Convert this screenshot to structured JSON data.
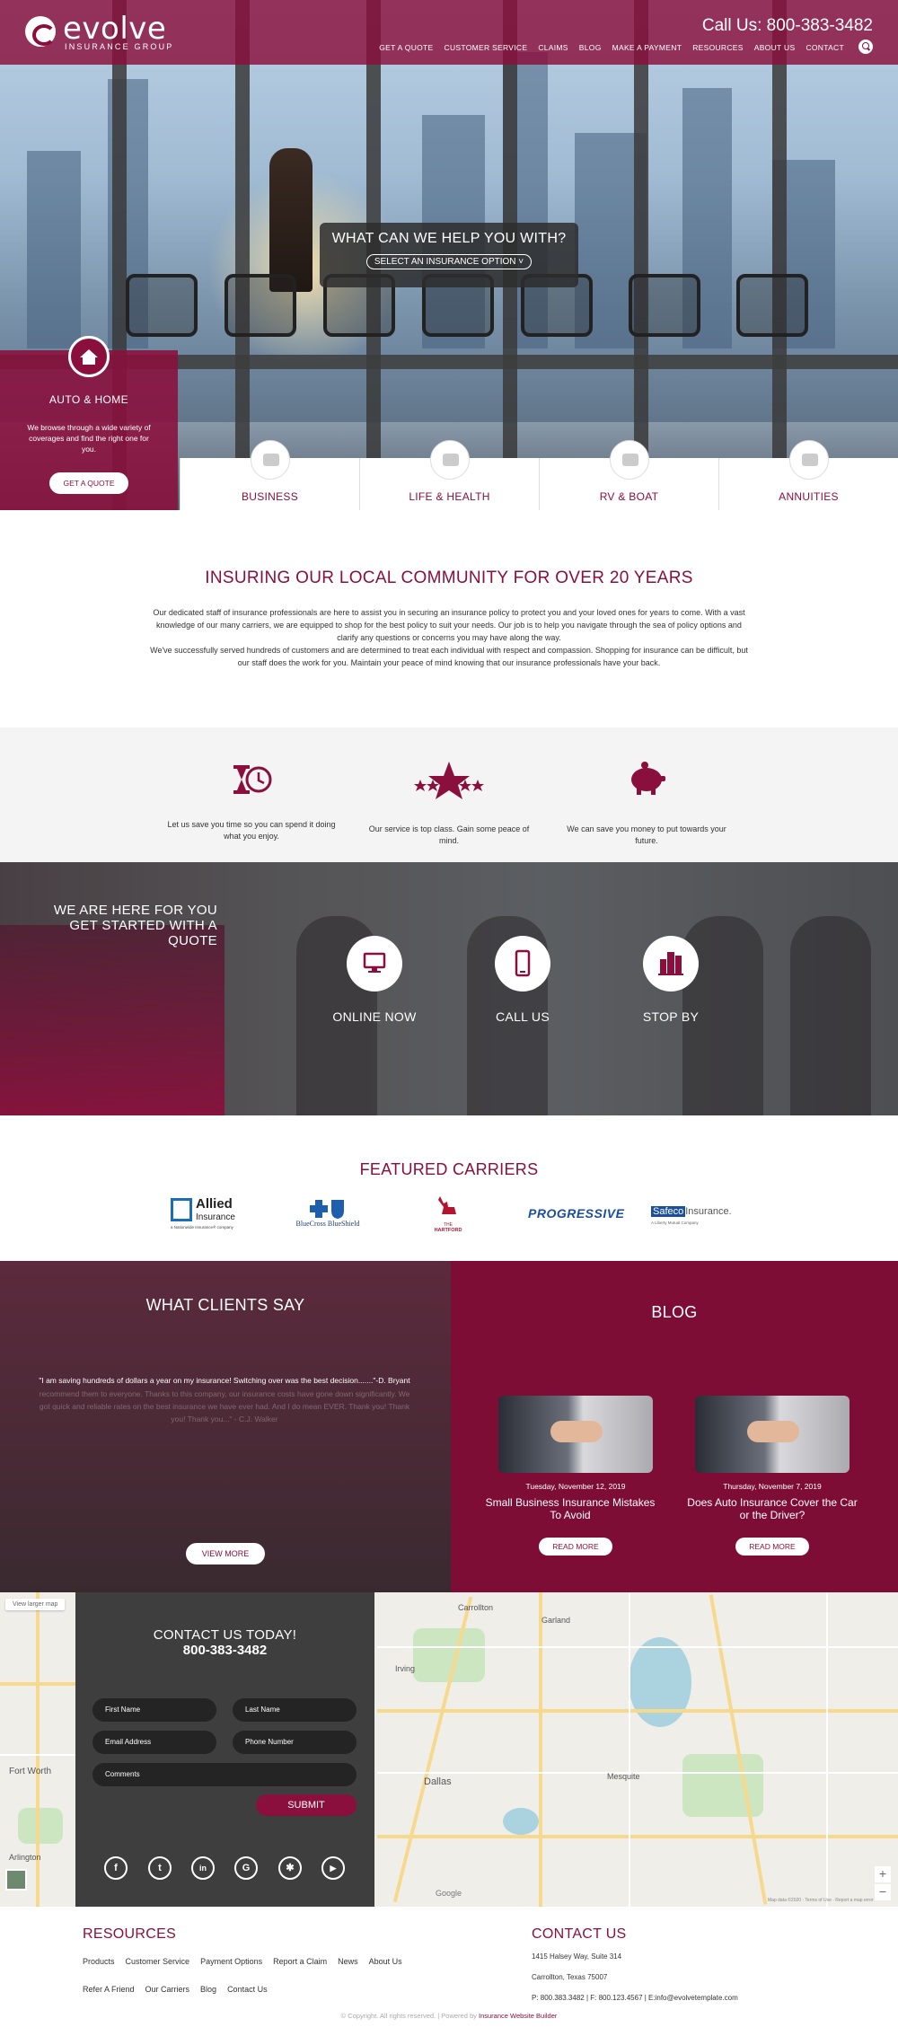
{
  "header": {
    "logo_text": "evolve",
    "logo_subtitle": "INSURANCE GROUP",
    "phone": "Call Us: 800-383-3482",
    "nav": [
      "GET A QUOTE",
      "CUSTOMER SERVICE",
      "CLAIMS",
      "BLOG",
      "MAKE A PAYMENT",
      "RESOURCES",
      "ABOUT US",
      "CONTACT"
    ],
    "search_icon": "search-icon"
  },
  "hero": {
    "question": "WHAT CAN WE HELP YOU WITH?",
    "select_label": "SELECT AN INSURANCE OPTION ˅",
    "auto_home": {
      "title": "AUTO & HOME",
      "text": "We browse through a wide variety of coverages and find the right one for you.",
      "button": "GET A QUOTE"
    },
    "tabs": [
      "BUSINESS",
      "LIFE & HEALTH",
      "RV & BOAT",
      "ANNUITIES"
    ]
  },
  "intro": {
    "title": "INSURING OUR LOCAL COMMUNITY FOR OVER 20 YEARS",
    "p1": "Our dedicated staff of insurance professionals are here to assist you in securing an insurance policy to protect you and your loved ones for years to come. With a vast knowledge of our many carriers, we are equipped to shop for the best policy to suit your needs. Our job is to help you navigate through the sea of policy options and clarify any questions or concerns you may have along the way.",
    "p2": "We've successfully served hundreds of customers and are determined to treat each individual with respect and compassion. Shopping for insurance can be difficult, but our staff does the work for you. Maintain your peace of mind knowing that our insurance professionals have your back."
  },
  "features": [
    {
      "icon": "hourglass-clock-icon",
      "text": "Let us save you time so you can spend it doing what you enjoy."
    },
    {
      "icon": "stars-icon",
      "text": "Our service is top class. Gain some peace of mind."
    },
    {
      "icon": "piggy-bank-icon",
      "text": "We can save you money to put towards your future."
    }
  ],
  "quote_section": {
    "title_line1": "WE ARE HERE FOR YOU",
    "title_line2": "GET STARTED WITH A QUOTE",
    "items": [
      {
        "icon": "monitor-icon",
        "label": "ONLINE NOW"
      },
      {
        "icon": "mobile-phone-icon",
        "label": "CALL US"
      },
      {
        "icon": "office-building-icon",
        "label": "STOP BY"
      }
    ]
  },
  "carriers": {
    "title": "FEATURED CARRIERS",
    "logos": {
      "allied_1": "Allied",
      "allied_2": "Insurance",
      "allied_3": "a Nationwide Insurance® company",
      "bcbs": "BlueCross BlueShield",
      "hartford_1": "THE",
      "hartford_2": "HARTFORD",
      "progressive": "PROGRESSIVE",
      "safeco_1": "Safeco",
      "safeco_2": "Insurance.",
      "safeco_3": "A Liberty Mutual Company"
    }
  },
  "clients": {
    "title": "WHAT CLIENTS SAY",
    "quote": "\"I am saving hundreds of dollars a year on my insurance! Switching over was the best decision.......\"-D. Bryant",
    "faded_quote": "recommend them to everyone. Thanks to this company, our insurance costs have gone down significantly. We got quick and reliable rates on the best insurance we have ever had. And I do mean EVER. Thank you! Thank you! Thank you...\" - C.J. Walker",
    "button": "VIEW MORE"
  },
  "blog": {
    "title": "BLOG",
    "posts": [
      {
        "date": "Tuesday, November 12, 2019",
        "title": "Small Business Insurance Mistakes To Avoid",
        "button": "READ MORE"
      },
      {
        "date": "Thursday, November 7, 2019",
        "title": "Does Auto Insurance Cover the Car or the Driver?",
        "button": "READ MORE"
      }
    ]
  },
  "contact": {
    "title": "CONTACT US TODAY!",
    "phone": "800-383-3482",
    "fields": {
      "first": "First Name",
      "last": "Last Name",
      "email": "Email Address",
      "phone": "Phone Number",
      "comments": "Comments"
    },
    "submit": "SUBMIT",
    "social": [
      "facebook-icon",
      "twitter-icon",
      "linkedin-icon",
      "google-icon",
      "yelp-icon",
      "youtube-icon"
    ],
    "social_glyphs": [
      "f",
      "t",
      "in",
      "G",
      "✱",
      "▶"
    ]
  },
  "map": {
    "larger_map": "View larger map",
    "cities": [
      "Garland",
      "Dallas",
      "Fort Worth",
      "Mesquite",
      "Carrollton",
      "Arlington",
      "Irving"
    ],
    "attribution": "Map data ©2020 · Terms of Use · Report a map error",
    "google": "Google"
  },
  "footer": {
    "resources_title": "RESOURCES",
    "links_row1": [
      "Products",
      "Customer Service",
      "Payment Options",
      "Report a Claim",
      "News",
      "About Us"
    ],
    "links_row2": [
      "Refer A Friend",
      "Our Carriers",
      "Blog",
      "Contact Us"
    ],
    "contact_title": "CONTACT US",
    "address1": "1415 Halsey Way, Suite 314",
    "address2": "Carrollton, Texas 75007",
    "phones": "P: 800.383.3482 | F: 800.123.4567 | E:info@evolvetemplate.com",
    "copyright": "© Copyright. All rights reserved. | Powered by",
    "powered_by": "Insurance Website Builder"
  },
  "colors": {
    "brand": "#8a0f3c",
    "dark": "#3e3e3e"
  }
}
